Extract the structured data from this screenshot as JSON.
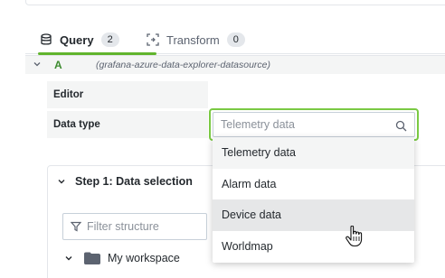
{
  "tabs": [
    {
      "label": "Query",
      "count": "2",
      "icon": "database-icon",
      "active": true
    },
    {
      "label": "Transform",
      "count": "0",
      "icon": "transform-icon",
      "active": false
    }
  ],
  "query": {
    "letter": "A",
    "datasource": "(grafana-azure-data-explorer-datasource)"
  },
  "fields": {
    "editor_label": "Editor",
    "datatype_label": "Data type",
    "datatype_placeholder": "Telemetry data"
  },
  "dropdown": {
    "options": [
      "Telemetry data",
      "Alarm data",
      "Device data",
      "Worldmap"
    ],
    "hovered": "Device data"
  },
  "step": {
    "title": "Step 1: Data selection",
    "filter_placeholder": "Filter structure",
    "tree_item": "My workspace"
  },
  "colors": {
    "accent": "#61b42d",
    "focus_border": "#7ac943",
    "query_letter": "#3d8b2f"
  }
}
